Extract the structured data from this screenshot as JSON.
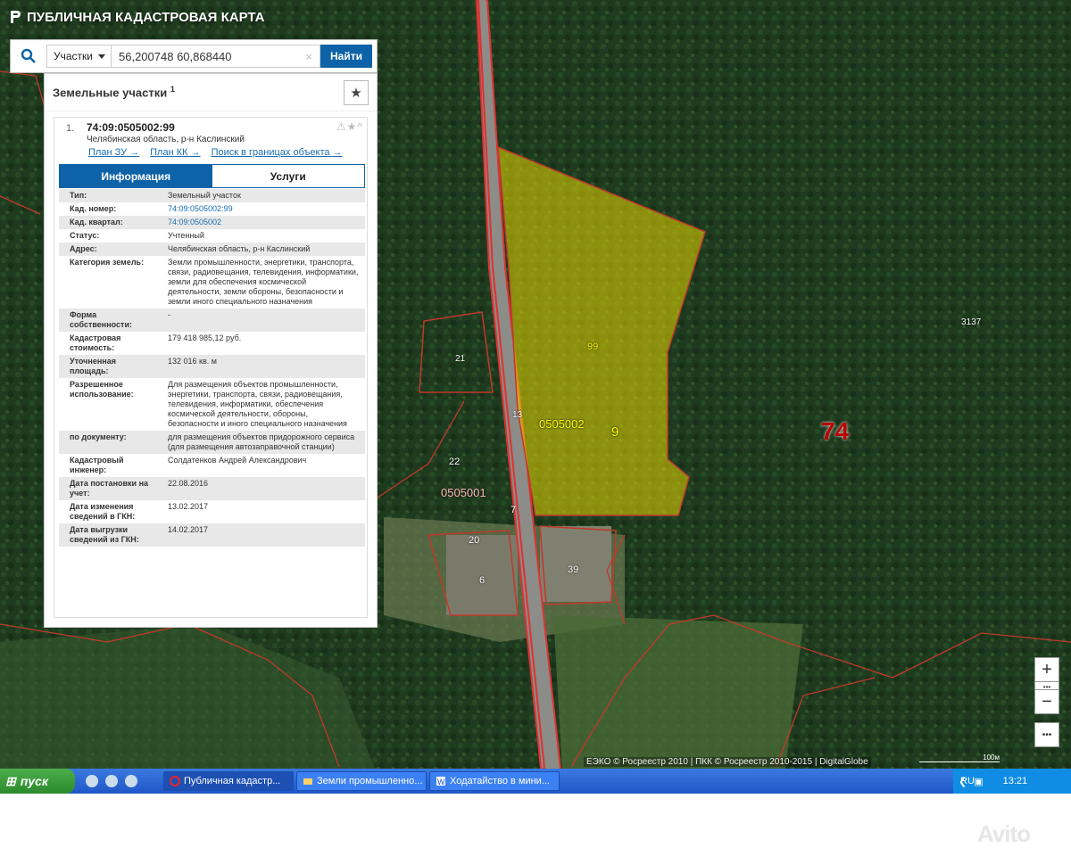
{
  "app": {
    "title": "ПУБЛИЧНАЯ КАДАСТРОВАЯ КАРТА"
  },
  "search": {
    "type_label": "Участки",
    "query": "56,200748 60,868440",
    "clear": "×",
    "find_label": "Найти"
  },
  "panel": {
    "title": "Земельные участки",
    "count": "1",
    "item": {
      "index": "1.",
      "cad_number": "74:09:0505002:99",
      "address": "Челябинская область, р-н Каслинский",
      "icons": "⚠★^",
      "links": [
        "План ЗУ →",
        "План КК →",
        "Поиск в границах объекта →"
      ],
      "tabs": [
        "Информация",
        "Услуги"
      ],
      "rows": [
        {
          "k": "Тип:",
          "v": "Земельный участок"
        },
        {
          "k": "Кад. номер:",
          "v": "74:09:0505002:99",
          "link": true
        },
        {
          "k": "Кад. квартал:",
          "v": "74:09:0505002",
          "link": true
        },
        {
          "k": "Статус:",
          "v": "Учтенный"
        },
        {
          "k": "Адрес:",
          "v": "Челябинская область, р-н Каслинский"
        },
        {
          "k": "Категория земель:",
          "v": "Земли промышленности, энергетики, транспорта, связи, радиовещания, телевидения, информатики, земли для обеспечения космической деятельности, земли обороны, безопасности и земли иного специального назначения"
        },
        {
          "k": "Форма собственности:",
          "v": "-"
        },
        {
          "k": "Кадастровая стоимость:",
          "v": "179 418 985,12 руб."
        },
        {
          "k": "Уточненная площадь:",
          "v": "132 016 кв. м"
        },
        {
          "k": "Разрешенное использование:",
          "v": "Для размещения объектов промышленности, энергетики, транспорта, связи, радиовещания, телевидения, информатики, обеспечения космической деятельности, обороны, безопасности и иного специального назначения"
        },
        {
          "k": "по документу:",
          "v": "для размещения объектов придорожного сервиса (для размещения автозаправочной станции)"
        },
        {
          "k": "Кадастровый инженер:",
          "v": "Солдатенков Андрей Александрович"
        },
        {
          "k": "Дата постановки на учет:",
          "v": "22.08.2016"
        },
        {
          "k": "Дата изменения сведений в ГКН:",
          "v": "13.02.2017"
        },
        {
          "k": "Дата выгрузки сведений из ГКН:",
          "v": "14.02.2017"
        }
      ]
    }
  },
  "map_labels": [
    "99",
    "0505002",
    "9",
    "74",
    "3137",
    "21",
    "22",
    "0505001",
    "13",
    "7",
    "20",
    "6",
    "39"
  ],
  "map_controls": {
    "zoom_in": "+",
    "dots": "•••",
    "zoom_out": "−",
    "more": "•••"
  },
  "attribution": "ЕЭКО © Росреестр 2010 | ПКК © Росреестр 2010-2015 | DigitalGlobe",
  "scale": "100м",
  "taskbar": {
    "start": "пуск",
    "tasks": [
      "Публичная кадастр...",
      "Земли промышленно...",
      "Ходатайство в мини..."
    ],
    "lang": "RU",
    "time": "13:21"
  },
  "watermark": "Avito",
  "colors": {
    "accent": "#0e63a8",
    "parcel_fill": "#e6d700",
    "boundary": "#c0392b"
  }
}
